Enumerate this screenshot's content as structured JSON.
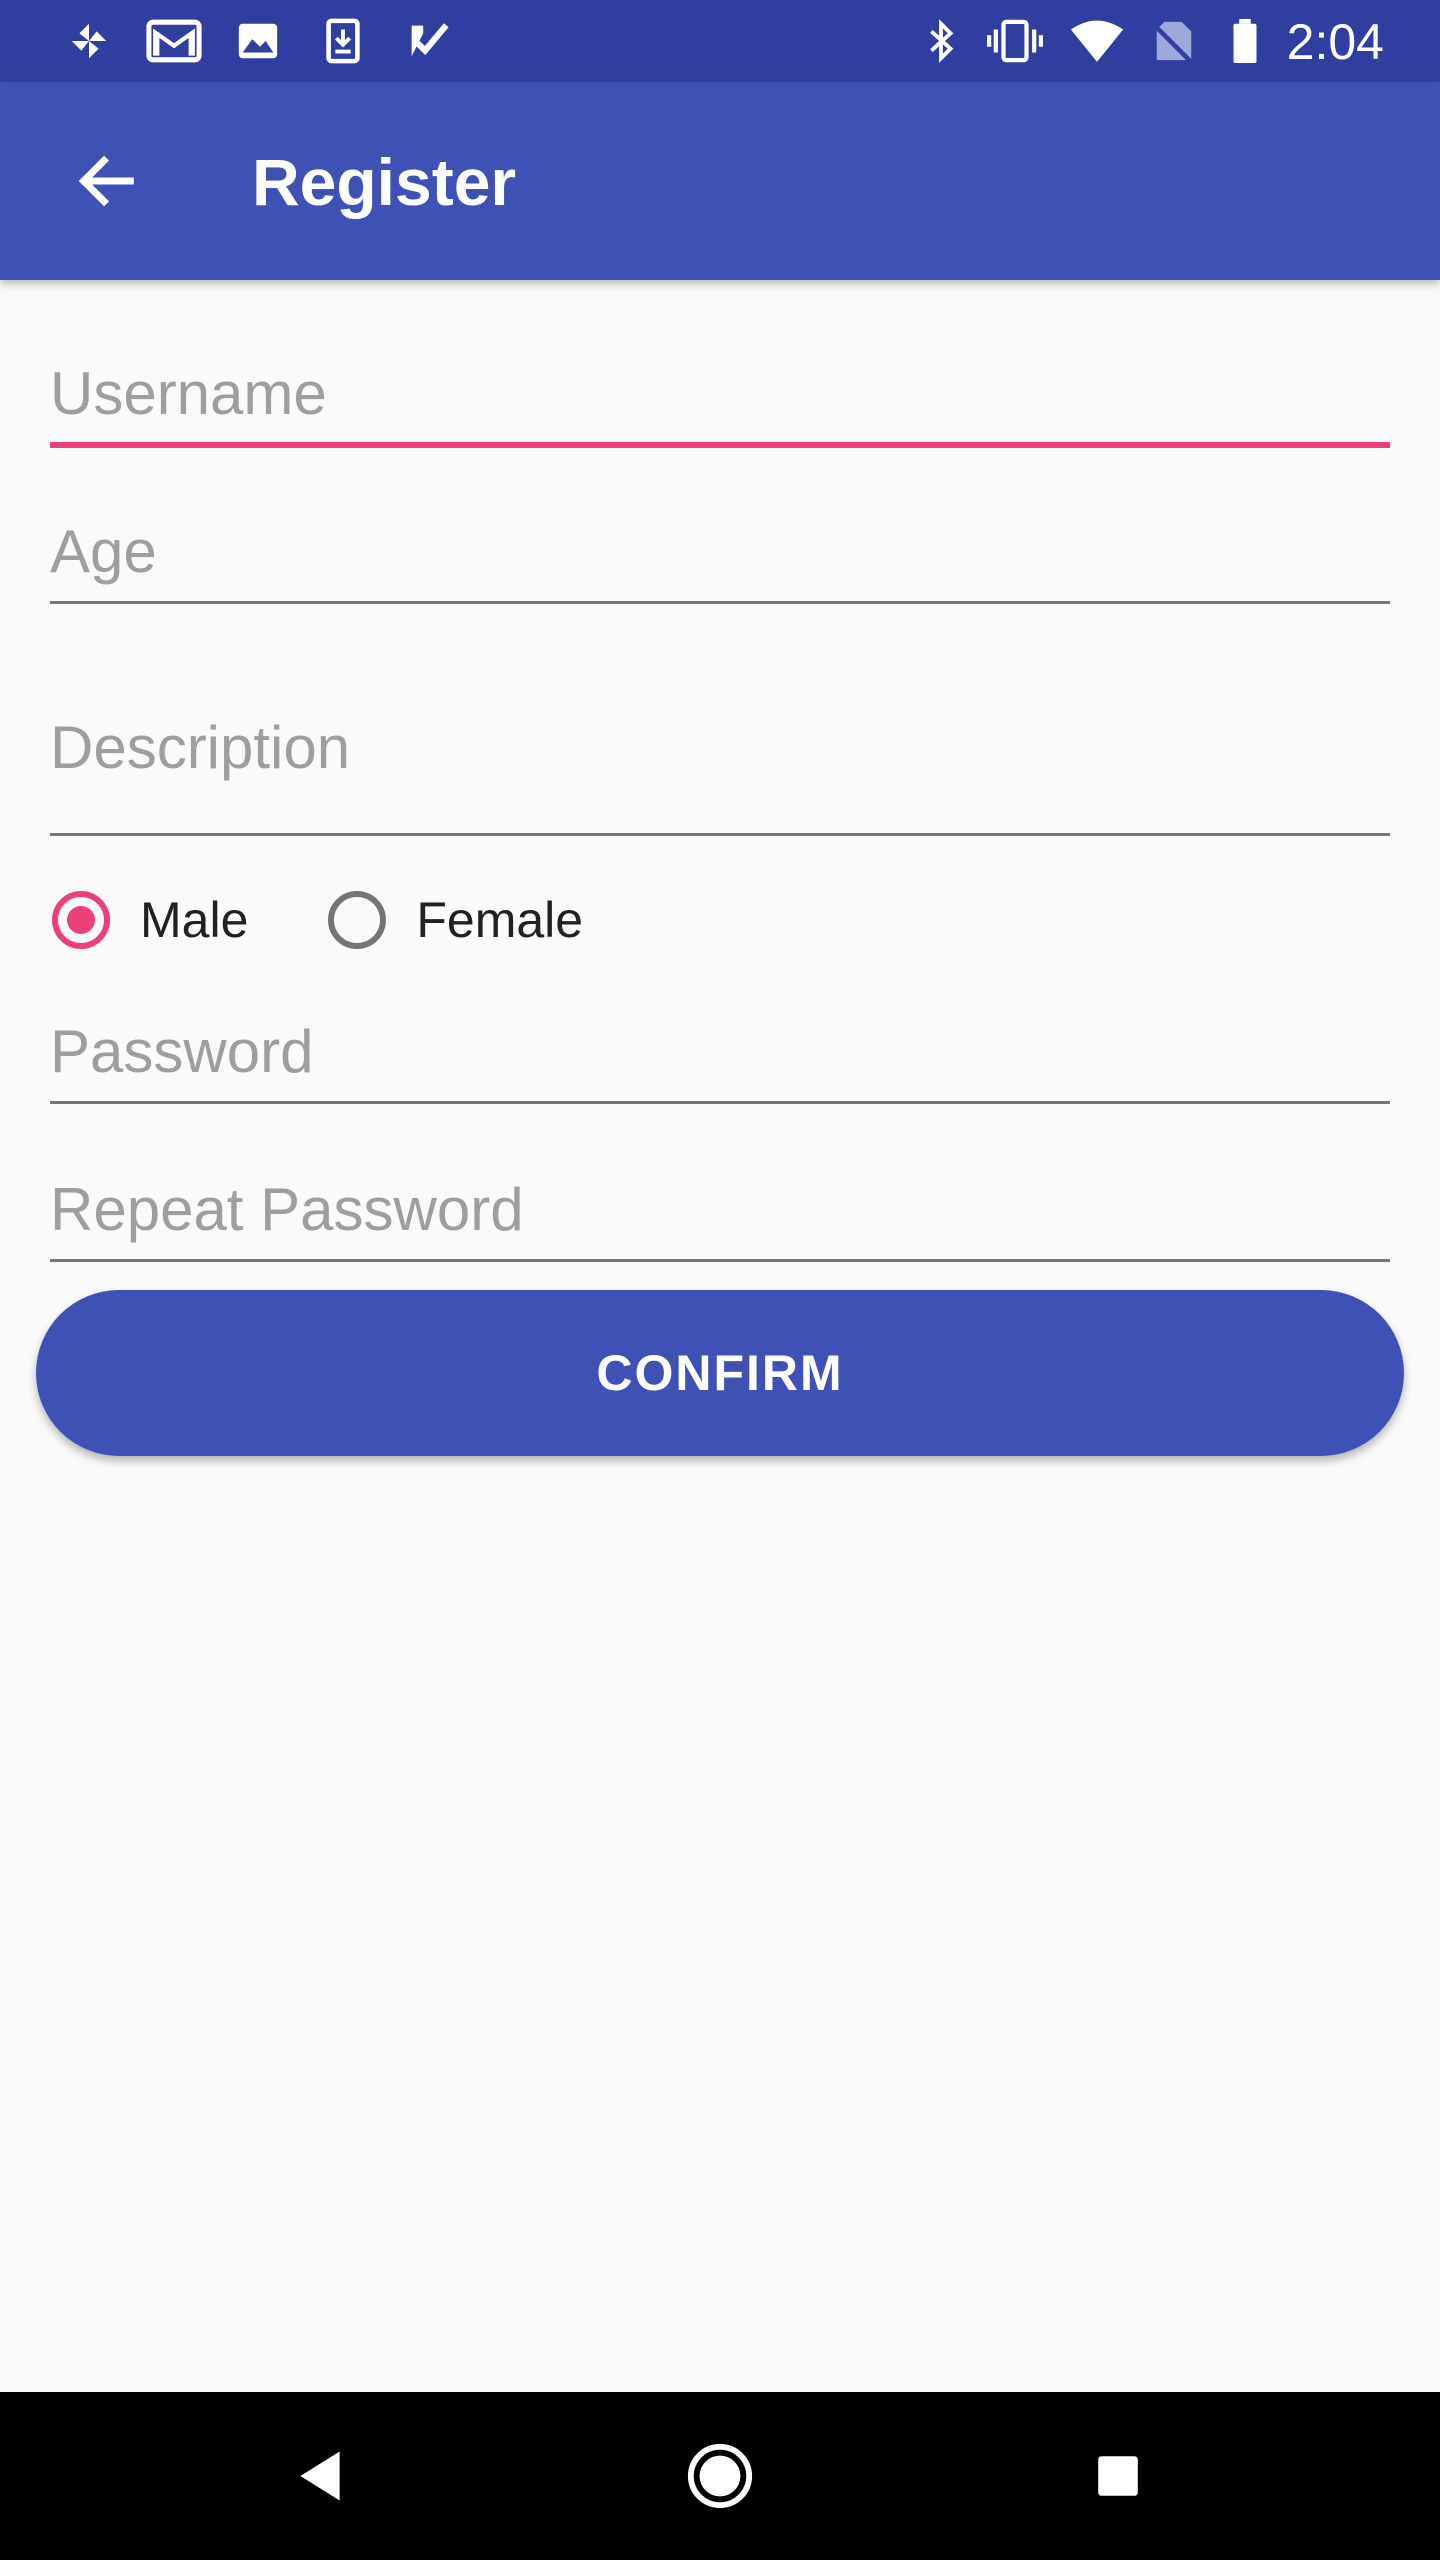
{
  "status_bar": {
    "time": "2:04",
    "left_icons": [
      "pinwheel-icon",
      "gmail-icon",
      "photos-icon",
      "download-icon",
      "tasks-icon"
    ],
    "right_icons": [
      "bluetooth-icon",
      "vibrate-icon",
      "wifi-icon",
      "no-sim-icon",
      "battery-icon"
    ]
  },
  "app_bar": {
    "title": "Register",
    "back_icon": "arrow-back-icon"
  },
  "form": {
    "username": {
      "placeholder": "Username",
      "value": "",
      "focused": true
    },
    "age": {
      "placeholder": "Age",
      "value": ""
    },
    "description": {
      "placeholder": "Description",
      "value": ""
    },
    "gender": {
      "options": [
        {
          "label": "Male",
          "checked": true
        },
        {
          "label": "Female",
          "checked": false
        }
      ]
    },
    "password": {
      "placeholder": "Password",
      "value": ""
    },
    "repeat_password": {
      "placeholder": "Repeat Password",
      "value": ""
    },
    "confirm_label": "CONFIRM"
  },
  "nav_bar": {
    "icons": [
      "back-triangle-icon",
      "home-circle-icon",
      "recents-square-icon"
    ]
  },
  "colors": {
    "status_bar": "#303f9f",
    "primary": "#3f51b5",
    "accent": "#ec407a",
    "background": "#fafafa",
    "hint_text": "#9e9e9e",
    "underline": "#757575"
  }
}
